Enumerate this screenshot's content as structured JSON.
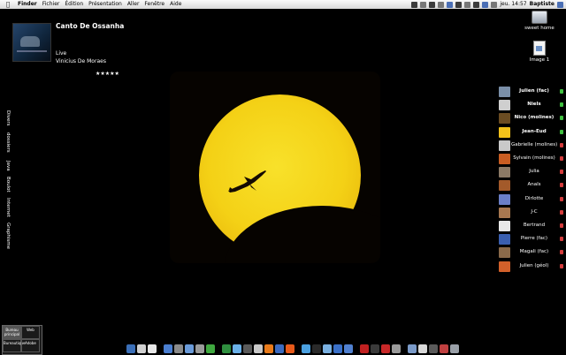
{
  "menubar": {
    "app": "Finder",
    "items": [
      "Fichier",
      "Édition",
      "Présentation",
      "Aller",
      "Fenêtre",
      "Aide"
    ],
    "clock": "jeu. 14:57",
    "user": "Baptiste"
  },
  "itunes": {
    "title": "Canto De Ossanha",
    "album": "Live",
    "artist": "Vinicius De Moraes",
    "stars": "★★★★★"
  },
  "desktop": {
    "icons": [
      {
        "label": "sweet home",
        "icon": "hard-drive-icon"
      },
      {
        "label": "Image 1",
        "icon": "document-icon"
      }
    ]
  },
  "side_dock": {
    "items": [
      "Divers",
      "dossiers",
      "Java",
      "Boulot",
      "Internet",
      "Graphisme"
    ]
  },
  "buddies": [
    {
      "name": "Julien (fac)",
      "bold": true,
      "status": "green",
      "avatar": "#7a8fa8"
    },
    {
      "name": "Niels",
      "bold": true,
      "status": "green",
      "avatar": "#cfcfcf"
    },
    {
      "name": "Nico (molines)",
      "bold": true,
      "status": "green",
      "avatar": "#6b4c22"
    },
    {
      "name": "Jean-Eud",
      "bold": true,
      "status": "green",
      "avatar": "#f2c21a"
    },
    {
      "name": "Gabrielle (molines)",
      "bold": false,
      "status": "red",
      "avatar": "#c9c9c9"
    },
    {
      "name": "Sylvain (molines)",
      "bold": false,
      "status": "red",
      "avatar": "#c95d22"
    },
    {
      "name": "Julia",
      "bold": false,
      "status": "red",
      "avatar": "#8c7a66"
    },
    {
      "name": "Anaïs",
      "bold": false,
      "status": "red",
      "avatar": "#a35a2a"
    },
    {
      "name": "Dirlotte",
      "bold": false,
      "status": "red",
      "avatar": "#6b7fc7"
    },
    {
      "name": "J-C",
      "bold": false,
      "status": "red",
      "avatar": "#a87850"
    },
    {
      "name": "Bertrand",
      "bold": false,
      "status": "red",
      "avatar": "#e8e8e8"
    },
    {
      "name": "Pierre (fac)",
      "bold": false,
      "status": "red",
      "avatar": "#3a5fb0"
    },
    {
      "name": "Magali (fac)",
      "bold": false,
      "status": "red",
      "avatar": "#8a6a4a"
    },
    {
      "name": "Julien (géol)",
      "bold": false,
      "status": "red",
      "avatar": "#d2602a"
    }
  ],
  "status_colors": {
    "green": "#3fbf3f",
    "red": "#d23b3b"
  },
  "spaces": [
    {
      "label": "Bureau principal",
      "active": true
    },
    {
      "label": "Web",
      "active": false
    },
    {
      "label": "Bureautique",
      "active": false
    },
    {
      "label": "Adobe",
      "active": false
    }
  ],
  "dock": {
    "groups": [
      [
        "#3b6fb8",
        "#d0d0d0",
        "#e8e8e8"
      ],
      [
        "#4a7ed0",
        "#8a8a8a",
        "#6a9ad8",
        "#9a9a9a",
        "#3fa83f"
      ],
      [
        "#2f8f3f",
        "#6ab0e8",
        "#5a5a5a",
        "#c8c8c8",
        "#e87a1a",
        "#3a6ac0",
        "#e85a1a"
      ],
      [
        "#4aa0e0",
        "#2a2a2a",
        "#7ab0e0",
        "#3a70c8",
        "#5080d0"
      ],
      [
        "#c02020",
        "#3a3a3a",
        "#c82828",
        "#9a9a9a"
      ],
      [
        "#7a9ac8",
        "#d8d8d8",
        "#5a5a5a",
        "#c04040",
        "#9aa0a8"
      ]
    ]
  }
}
